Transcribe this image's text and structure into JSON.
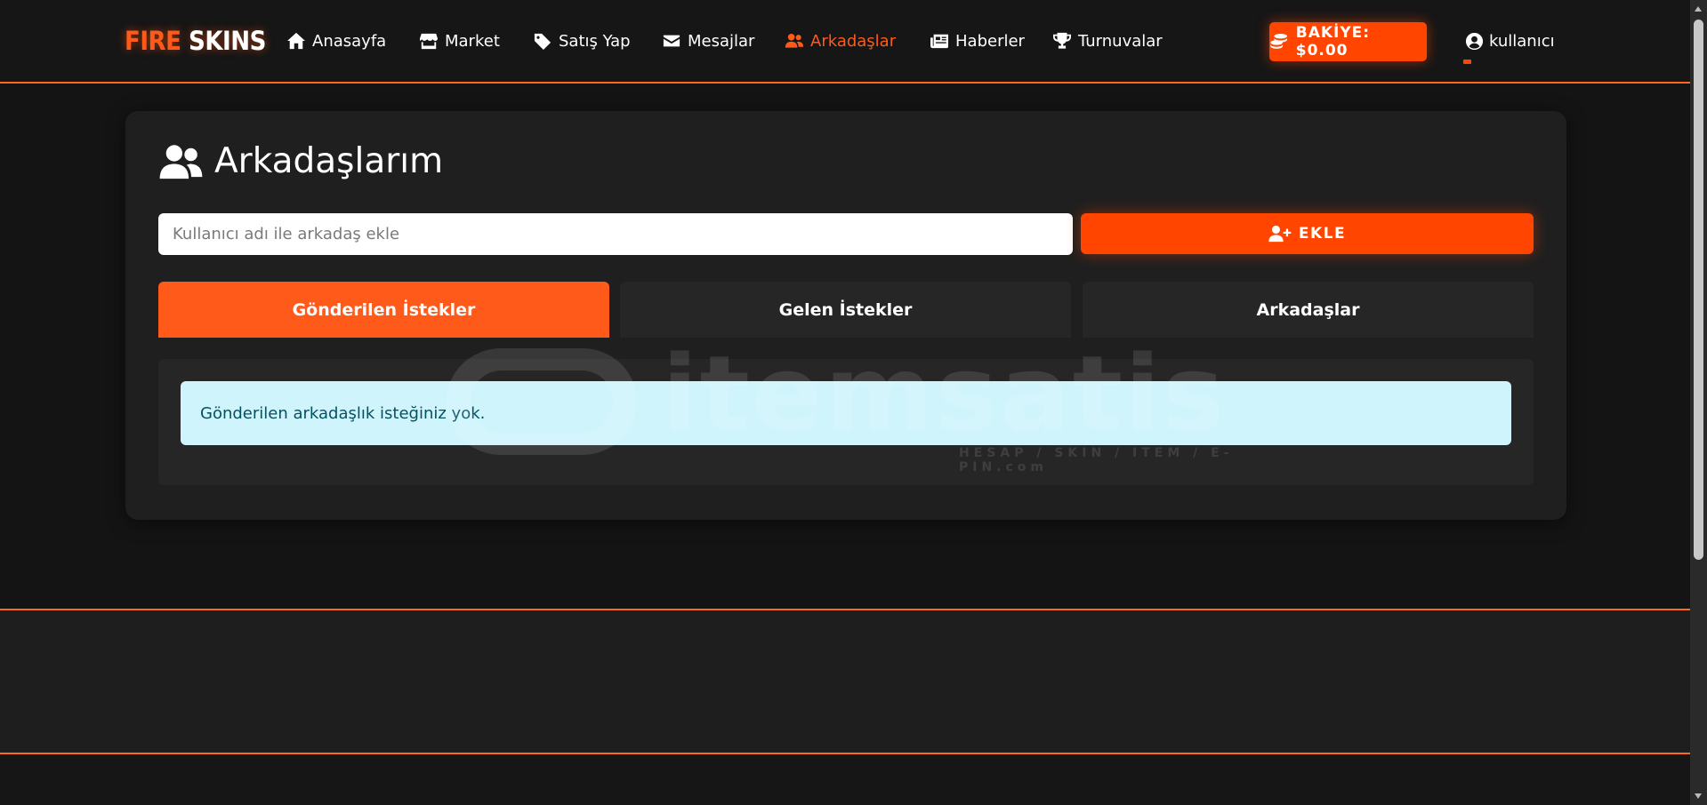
{
  "brand": {
    "part1": "FIRE",
    "part2": "SKINS"
  },
  "nav": {
    "items": [
      {
        "label": "Anasayfa",
        "icon": "home-icon"
      },
      {
        "label": "Market",
        "icon": "store-icon"
      },
      {
        "label": "Satış Yap",
        "icon": "tag-icon"
      },
      {
        "label": "Mesajlar",
        "icon": "envelope-icon"
      },
      {
        "label": "Arkadaşlar",
        "icon": "users-icon",
        "active": true
      },
      {
        "label": "Haberler",
        "icon": "newspaper-icon"
      },
      {
        "label": "Turnuvalar",
        "icon": "trophy-icon"
      }
    ],
    "balance_label": "BAKİYE: $0.00",
    "user_label": "kullanıcı"
  },
  "page": {
    "title": "Arkadaşlarım",
    "search_placeholder": "Kullanıcı adı ile arkadaş ekle",
    "add_button_label": "EKLE",
    "tabs": [
      {
        "label": "Gönderilen İstekler",
        "active": true
      },
      {
        "label": "Gelen İstekler"
      },
      {
        "label": "Arkadaşlar"
      }
    ],
    "empty_message": "Gönderilen arkadaşlık isteğiniz yok."
  },
  "watermark": {
    "word": "itemsatis",
    "sub": "HESAP / SKIN / ITEM / E-PIN",
    "suffix": ".com"
  },
  "colors": {
    "accent": "#ff4500",
    "accent_tab": "#ff5a1a",
    "alert_bg": "#cff4fc",
    "alert_text": "#055160"
  }
}
